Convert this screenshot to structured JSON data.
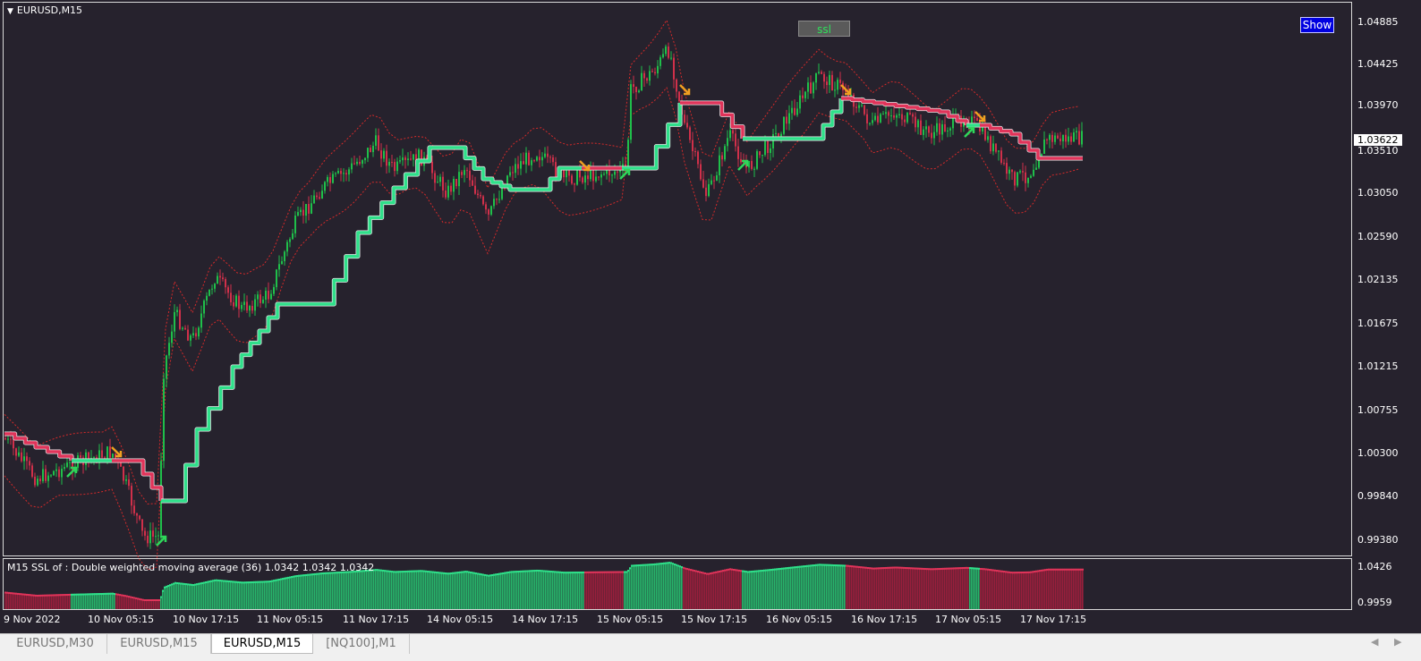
{
  "chart": {
    "title": "EURUSD,M15",
    "ssl_button": "ssl",
    "show_button": "Show",
    "current_price": "1.03622",
    "price_axis": [
      "1.04885",
      "1.04425",
      "1.03970",
      "1.03510",
      "1.03050",
      "1.02590",
      "1.02135",
      "1.01675",
      "1.01215",
      "1.00755",
      "1.00300",
      "0.99840",
      "0.99380"
    ],
    "indicator_title": "M15  SSL of : Double weighted moving average (36)  1.0342 1.0342 1.0342",
    "indicator_axis": [
      "1.0426",
      "0.9959"
    ],
    "time_axis": [
      "9 Nov 2022",
      "10 Nov 05:15",
      "10 Nov 17:15",
      "11 Nov 05:15",
      "11 Nov 17:15",
      "14 Nov 05:15",
      "14 Nov 17:15",
      "15 Nov 05:15",
      "15 Nov 17:15",
      "16 Nov 05:15",
      "16 Nov 17:15",
      "17 Nov 05:15",
      "17 Nov 17:15"
    ]
  },
  "colors": {
    "background": "#26222d",
    "ssl_up": "#2fe08a",
    "ssl_down": "#e0345a",
    "candle_up": "#1fbf4a",
    "candle_down": "#d0304a",
    "envelope": "#d42a2a"
  },
  "tabs": [
    {
      "label": "EURUSD,M30",
      "active": false
    },
    {
      "label": "EURUSD,M15",
      "active": false
    },
    {
      "label": "EURUSD,M15",
      "active": true
    },
    {
      "label": "[NQ100],M1",
      "active": false
    }
  ]
}
